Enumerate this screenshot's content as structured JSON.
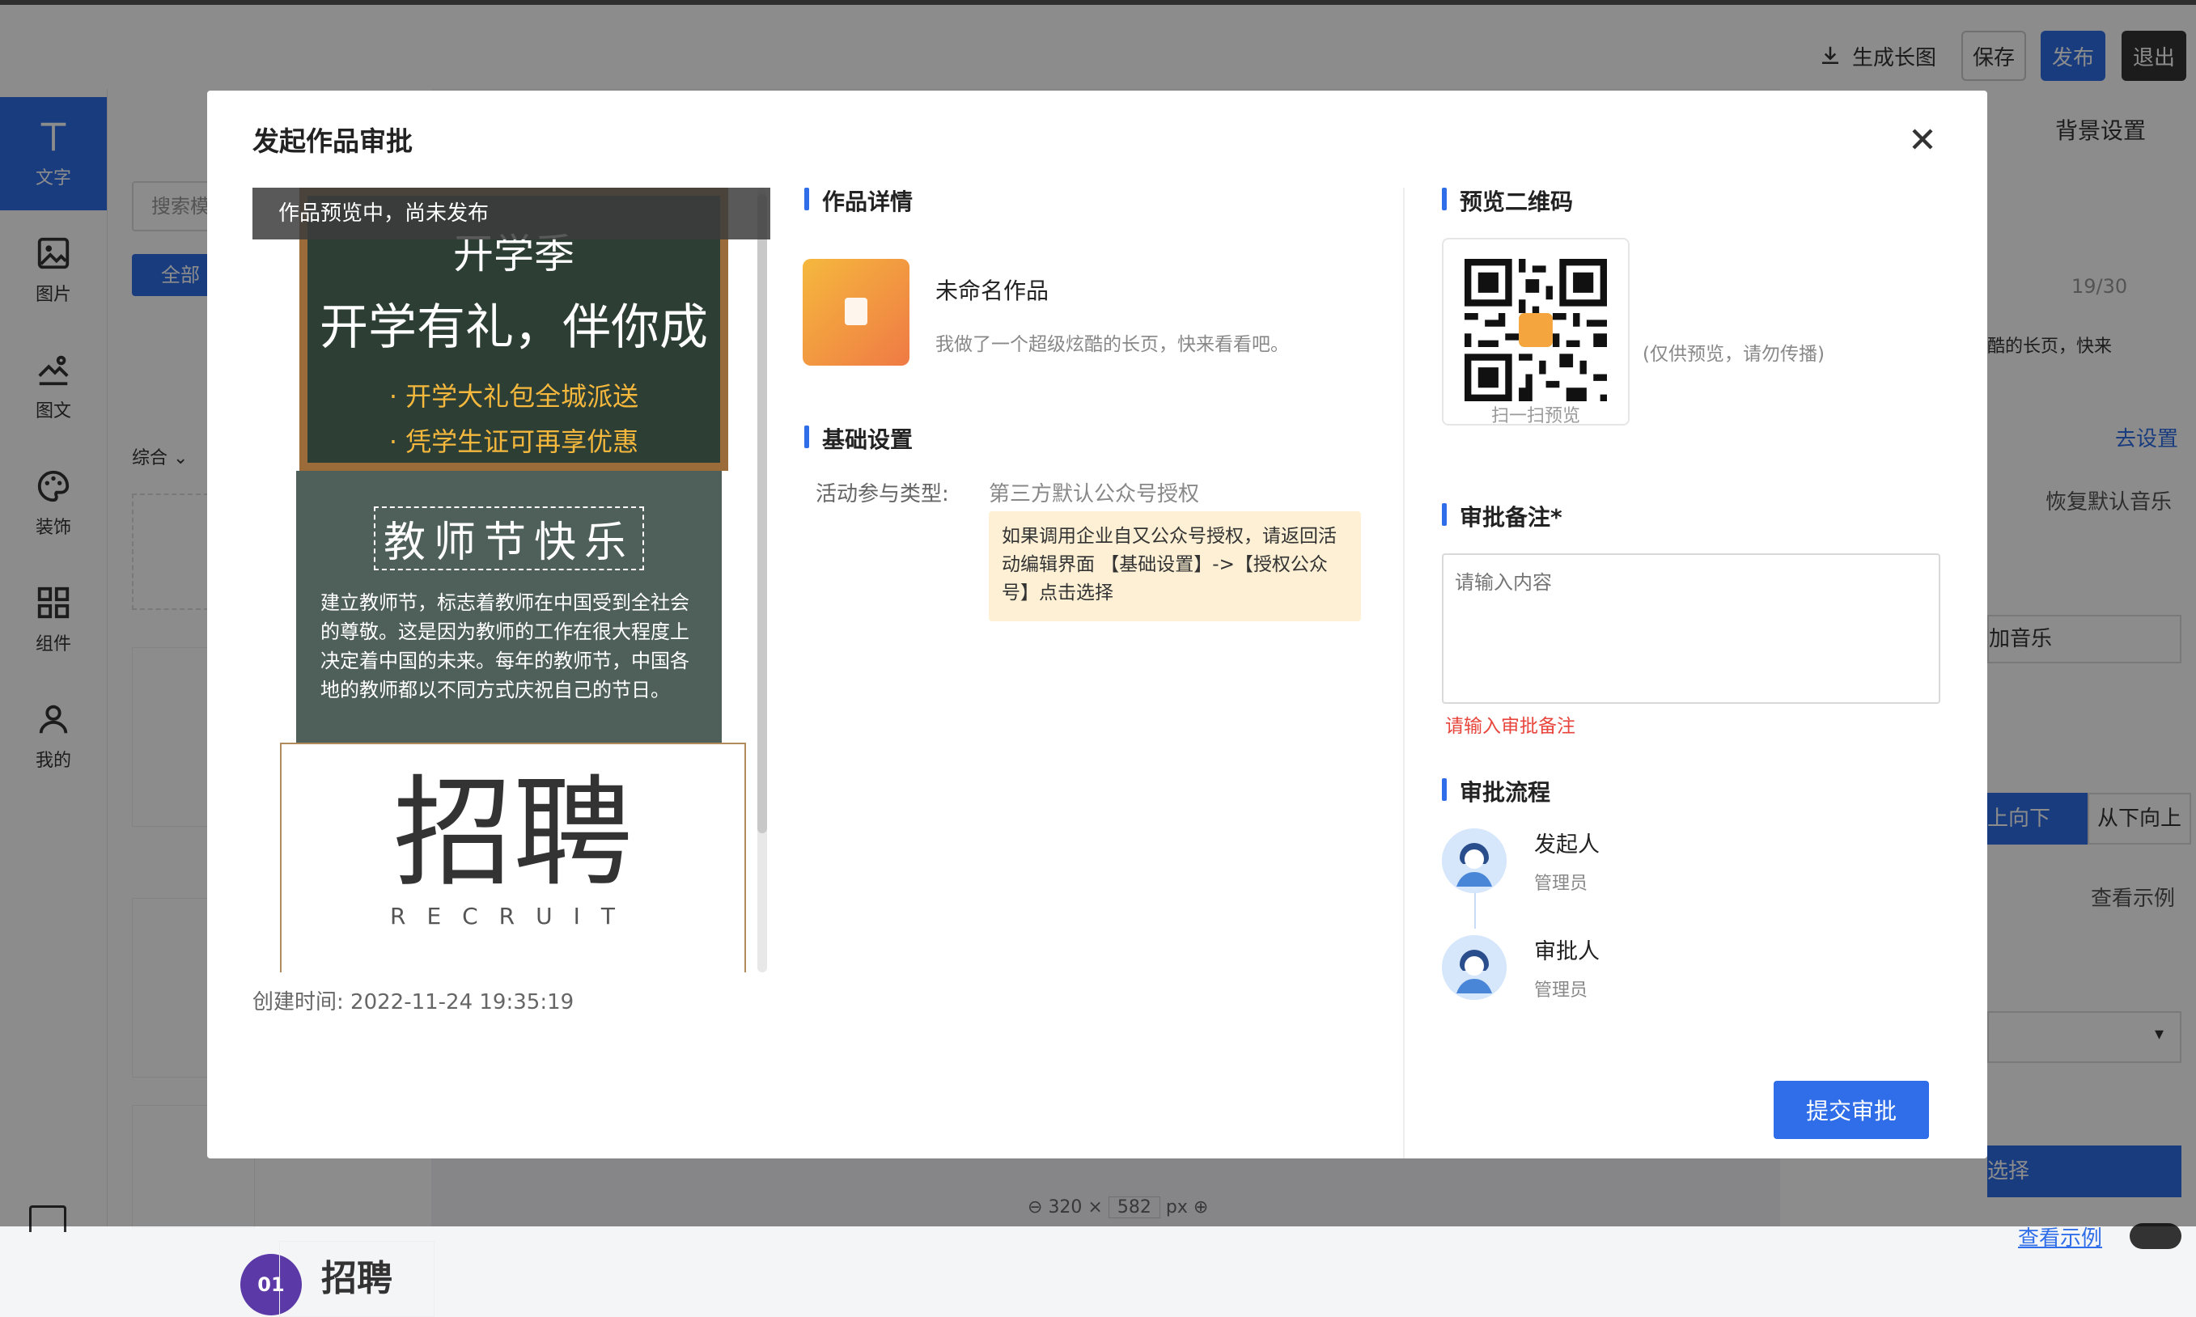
{
  "toolbar": {
    "generate_long_image": "生成长图",
    "save": "保存",
    "publish": "发布",
    "exit": "退出"
  },
  "left_rail": {
    "items": [
      {
        "label": "文字",
        "icon": "text-icon"
      },
      {
        "label": "图片",
        "icon": "image-icon"
      },
      {
        "label": "图文",
        "icon": "image-text-icon"
      },
      {
        "label": "装饰",
        "icon": "palette-icon"
      },
      {
        "label": "组件",
        "icon": "components-icon"
      },
      {
        "label": "我的",
        "icon": "user-icon"
      }
    ]
  },
  "panel2": {
    "search_placeholder": "搜索模",
    "filter_all": "全部",
    "sort_label": "综合",
    "thumb_label": "招聘",
    "badge": "01"
  },
  "right_panel": {
    "title": "背景设置",
    "char_count": "19/30",
    "desc_snippet": "酷的长页，快来",
    "go_settings": "去设置",
    "restore_music": "恢复默认音乐",
    "add_music": "加音乐",
    "dir_top_down": "上向下",
    "dir_bottom_up": "从下向上",
    "view_example": "查看示例",
    "select": "选择",
    "view_example_link": "查看示例"
  },
  "canvas": {
    "width": "320",
    "height": "582",
    "unit": "px"
  },
  "modal": {
    "title": "发起作品审批",
    "preview": {
      "banner": "作品预览中，尚未发布",
      "poster1_line1": "开学季",
      "poster1_line2": "开学有礼，伴你成",
      "poster1_bullet1": "· 开学大礼包全城派送",
      "poster1_bullet2": "· 凭学生证可再享优惠",
      "poster2_title": "教师节快乐",
      "poster2_body": "建立教师节，标志着教师在中国受到全社会的尊敬。这是因为教师的工作在很大程度上决定着中国的未来。每年的教师节，中国各地的教师都以不同方式庆祝自己的节日。",
      "poster3_title": "招聘",
      "poster3_sub": "RECRUIT",
      "created_time": "创建时间: 2022-11-24 19:35:19"
    },
    "details": {
      "section_title": "作品详情",
      "work_name": "未命名作品",
      "work_desc": "我做了一个超级炫酷的长页，快来看看吧。"
    },
    "basic": {
      "section_title": "基础设置",
      "type_label": "活动参与类型:",
      "type_value": "第三方默认公众号授权",
      "tip": "如果调用企业自又公众号授权，请返回活动编辑界面 【基础设置】->【授权公众号】点击选择"
    },
    "qr": {
      "section_title": "预览二维码",
      "scan_label": "扫一扫预览",
      "note": "(仅供预览，请勿传播)"
    },
    "remark": {
      "section_title": "审批备注",
      "required_mark": "*",
      "placeholder": "请输入内容",
      "error": "请输入审批备注"
    },
    "flow": {
      "section_title": "审批流程",
      "steps": [
        {
          "role": "发起人",
          "user": "管理员"
        },
        {
          "role": "审批人",
          "user": "管理员"
        }
      ]
    },
    "submit": "提交审批"
  },
  "colors": {
    "primary": "#2f6ee8",
    "error": "#e8453c",
    "tip_bg": "#fdf0d5",
    "chalkboard": "#2d3f35",
    "accent_orange": "#f5b83d"
  }
}
